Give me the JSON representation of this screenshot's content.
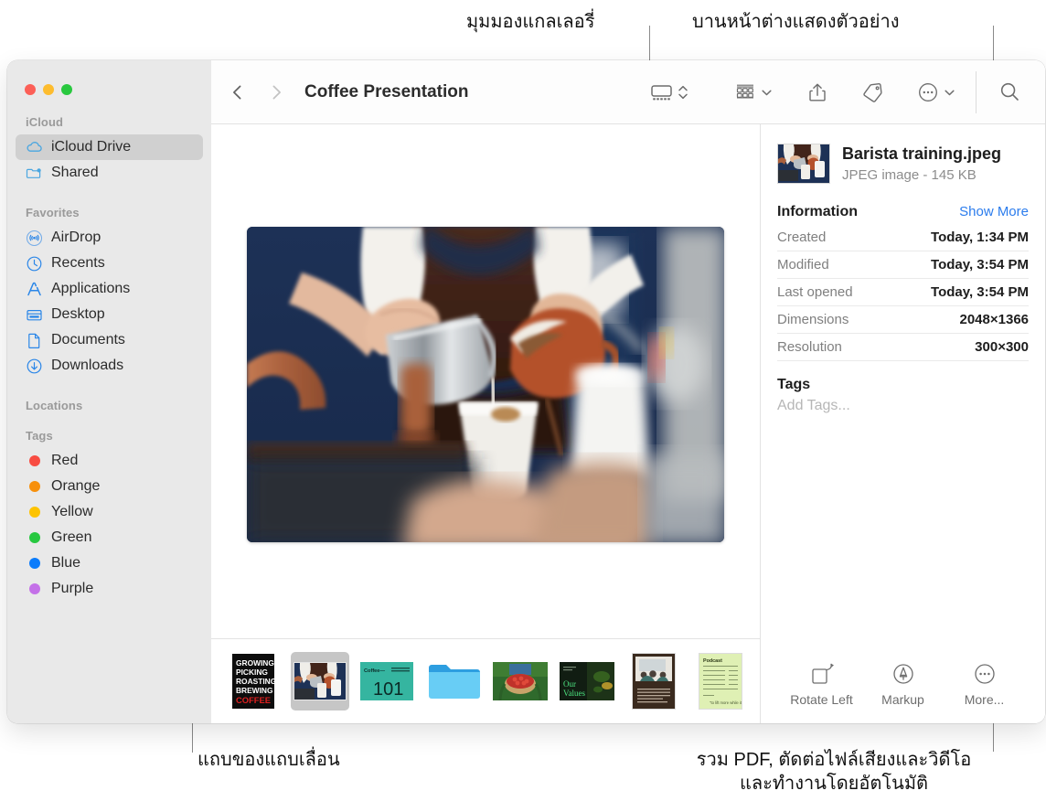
{
  "callouts": {
    "gallery_view": "มุมมองแกลเลอรี่",
    "preview_pane": "บานหน้าต่างแสดงตัวอย่าง",
    "filmstrip": "แถบของแถบเลื่อน",
    "more_tools": "รวม PDF, ตัดต่อไฟล์เสียงและวิดีโอ และทำงานโดยอัตโนมัติ"
  },
  "window": {
    "title": "Coffee Presentation"
  },
  "toolbar": {
    "back_icon": "chevron-left-icon",
    "forward_icon": "chevron-right-icon",
    "view_icon": "gallery-view-icon",
    "view_stepper_icon": "up-down-chevron-icon",
    "group_icon": "group-items-icon",
    "group_chevron_icon": "chevron-down-icon",
    "share_icon": "share-icon",
    "tag_icon": "tag-icon",
    "more_icon": "ellipsis-circle-icon",
    "more_chevron_icon": "chevron-down-icon",
    "search_icon": "search-icon"
  },
  "sidebar": {
    "sections": [
      {
        "header": "iCloud",
        "items": [
          {
            "label": "iCloud Drive",
            "icon": "cloud-icon",
            "selected": true
          },
          {
            "label": "Shared",
            "icon": "shared-folder-icon",
            "selected": false
          }
        ]
      },
      {
        "header": "Favorites",
        "items": [
          {
            "label": "AirDrop",
            "icon": "airdrop-icon",
            "selected": false
          },
          {
            "label": "Recents",
            "icon": "clock-icon",
            "selected": false
          },
          {
            "label": "Applications",
            "icon": "applications-icon",
            "selected": false
          },
          {
            "label": "Desktop",
            "icon": "desktop-icon",
            "selected": false
          },
          {
            "label": "Documents",
            "icon": "document-icon",
            "selected": false
          },
          {
            "label": "Downloads",
            "icon": "downloads-icon",
            "selected": false
          }
        ]
      },
      {
        "header": "Locations",
        "items": []
      },
      {
        "header": "Tags",
        "items": [
          {
            "label": "Red",
            "icon": "tag-dot-icon",
            "color": "#f84c42",
            "selected": false
          },
          {
            "label": "Orange",
            "icon": "tag-dot-icon",
            "color": "#f7900c",
            "selected": false
          },
          {
            "label": "Yellow",
            "icon": "tag-dot-icon",
            "color": "#fdc300",
            "selected": false
          },
          {
            "label": "Green",
            "icon": "tag-dot-icon",
            "color": "#27c840",
            "selected": false
          },
          {
            "label": "Blue",
            "icon": "tag-dot-icon",
            "color": "#0b7cfb",
            "selected": false
          },
          {
            "label": "Purple",
            "icon": "tag-dot-icon",
            "color": "#c munged",
            "selected": false
          }
        ]
      }
    ]
  },
  "tag_colors": {
    "red": "#f84c42",
    "orange": "#f7900c",
    "yellow": "#fdc300",
    "green": "#27c840",
    "blue": "#0b7cfb",
    "purple": "#c471e8"
  },
  "filmstrip": {
    "items": [
      {
        "name": "coffee-poster-thumbnail",
        "type": "image",
        "caption": "GROWING PICKING ROASTING BREWING COFFEE",
        "selected": false
      },
      {
        "name": "barista-training-thumbnail",
        "type": "image",
        "caption": "",
        "selected": true
      },
      {
        "name": "coffee-101-thumbnail",
        "type": "image",
        "caption": "101",
        "selected": false
      },
      {
        "name": "folder-thumbnail",
        "type": "folder",
        "caption": "",
        "selected": false
      },
      {
        "name": "cherries-basket-thumbnail",
        "type": "image",
        "caption": "",
        "selected": false
      },
      {
        "name": "our-values-thumbnail",
        "type": "image",
        "caption": "Our Values",
        "selected": false
      },
      {
        "name": "meeting-document-thumbnail",
        "type": "document",
        "caption": "",
        "selected": false
      },
      {
        "name": "spreadsheet-thumbnail",
        "type": "document",
        "caption": "",
        "selected": false
      }
    ]
  },
  "preview": {
    "file_name": "Barista training.jpeg",
    "file_meta": "JPEG image - 145 KB",
    "information_title": "Information",
    "show_more": "Show More",
    "info_rows": [
      {
        "key": "Created",
        "value": "Today, 1:34 PM"
      },
      {
        "key": "Modified",
        "value": "Today, 3:54 PM"
      },
      {
        "key": "Last opened",
        "value": "Today, 3:54 PM"
      },
      {
        "key": "Dimensions",
        "value": "2048×1366"
      },
      {
        "key": "Resolution",
        "value": "300×300"
      }
    ],
    "tags_title": "Tags",
    "add_tags_placeholder": "Add Tags...",
    "actions": [
      {
        "label": "Rotate Left",
        "icon": "rotate-left-icon"
      },
      {
        "label": "Markup",
        "icon": "markup-icon"
      },
      {
        "label": "More...",
        "icon": "ellipsis-circle-icon"
      }
    ]
  },
  "colors": {
    "accent_link": "#2b7ced",
    "sidebar_bg": "#e9e9e9",
    "selection_bg": "#d0d0d0"
  }
}
